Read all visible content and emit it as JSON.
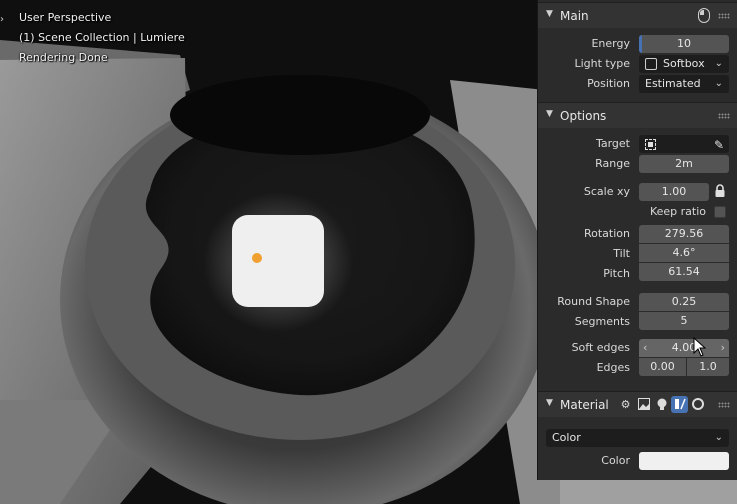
{
  "viewport": {
    "view_name": "User Perspective",
    "collection": "(1) Scene Collection | Lumiere",
    "render_status": "Rendering Done"
  },
  "main": {
    "title": "Main",
    "energy_label": "Energy",
    "energy_value": "10",
    "energy_fill": 0.03,
    "light_type_label": "Light type",
    "light_type_value": "Softbox",
    "position_label": "Position",
    "position_value": "Estimated"
  },
  "options": {
    "title": "Options",
    "target_label": "Target",
    "range_label": "Range",
    "range_value": "2m",
    "scale_label": "Scale xy",
    "scale_value": "1.00",
    "keep_ratio_label": "Keep ratio",
    "rotation_label": "Rotation",
    "rotation_value": "279.56",
    "tilt_label": "Tilt",
    "tilt_value": "4.6°",
    "pitch_label": "Pitch",
    "pitch_value": "61.54",
    "round_shape_label": "Round Shape",
    "round_shape_value": "0.25",
    "segments_label": "Segments",
    "segments_value": "5",
    "soft_edges_label": "Soft edges",
    "soft_edges_value": "4.00",
    "edges_label": "Edges",
    "edges_value_1": "0.00",
    "edges_value_2": "1.0"
  },
  "material": {
    "title": "Material",
    "color_mode": "Color",
    "color_label": "Color",
    "color_swatch": "#f0f0f0",
    "icons": [
      "gear-icon",
      "image-icon",
      "bulb-icon",
      "gradient-icon",
      "circle-icon"
    ]
  },
  "colors": {
    "accent": "#4772b3",
    "light_dot": "#f0a030"
  }
}
